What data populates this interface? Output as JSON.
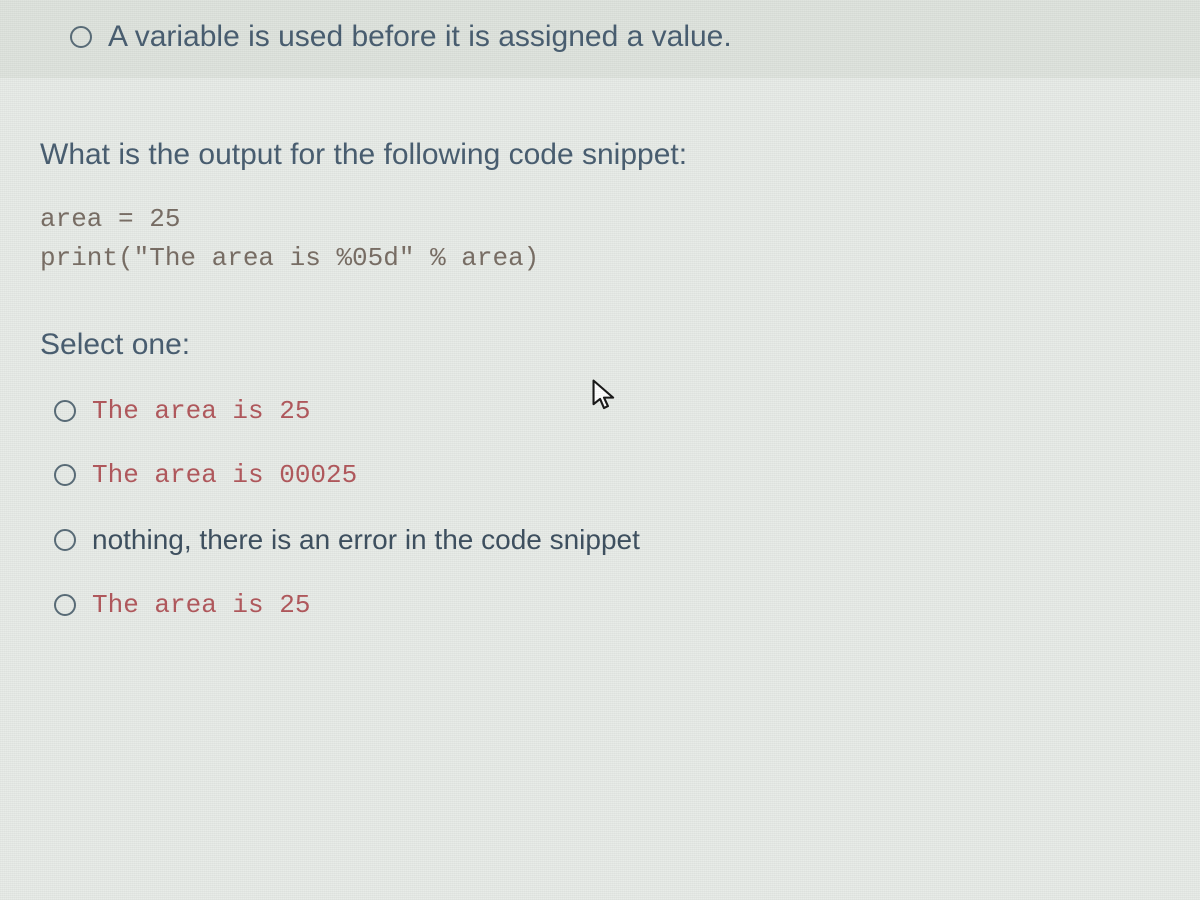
{
  "top_option": {
    "label": "A variable is used before it is assigned a value."
  },
  "question": {
    "prompt": "What is the output for the following code snippet:",
    "code": {
      "line1": "area = 25",
      "line2": "print(\"The area is %05d\" % area)"
    },
    "select_label": "Select one:"
  },
  "options": [
    {
      "label": "The area is 25",
      "style": "mono"
    },
    {
      "label": "The area is 00025",
      "style": "mono"
    },
    {
      "label": "nothing, there is an error in the code snippet",
      "style": "normal"
    },
    {
      "label": "The area is 25",
      "style": "mono"
    }
  ]
}
